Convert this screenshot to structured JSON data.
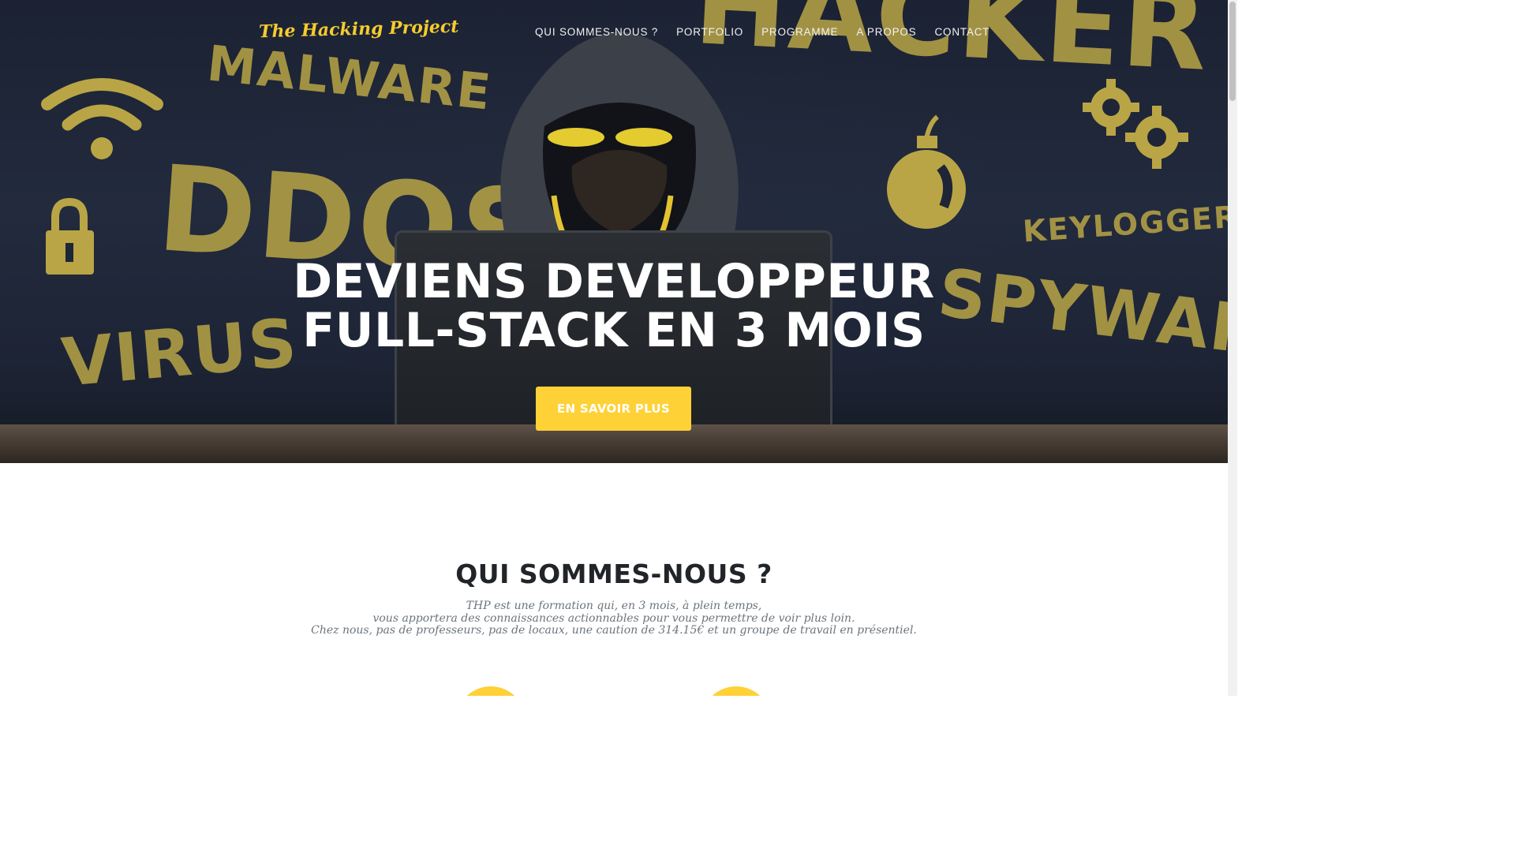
{
  "nav": {
    "brand": "The Hacking Project",
    "links": [
      "QUI SOMMES-NOUS ?",
      "PORTFOLIO",
      "PROGRAMME",
      "A PROPOS",
      "CONTACT"
    ]
  },
  "hero": {
    "title_line1": "DEVIENS DEVELOPPEUR",
    "title_line2": "FULL-STACK EN 3 MOIS",
    "cta_label": "EN SAVOIR PLUS",
    "background_words": [
      "MALWARE",
      "DDOS",
      "VIRUS",
      "HACKER",
      "KEYLOGGER",
      "SPYWARE"
    ]
  },
  "about": {
    "title": "QUI SOMMES-NOUS ?",
    "lines": [
      "THP est une formation qui, en 3 mois, à plein temps,",
      "vous apportera des connaissances actionnables pour vous permettre de voir plus loin.",
      "Chez nous, pas de professeurs, pas de locaux, une caution de 314.15€ et un groupe de travail en présentiel."
    ]
  },
  "colors": {
    "accent": "#fed136",
    "hero_bg": "#1f2638",
    "text_dark": "#212529",
    "text_muted": "#6c757d"
  },
  "icons": [
    "wifi-icon",
    "lock-icon",
    "bomb-icon",
    "gears-icon",
    "key-tag-icon"
  ]
}
